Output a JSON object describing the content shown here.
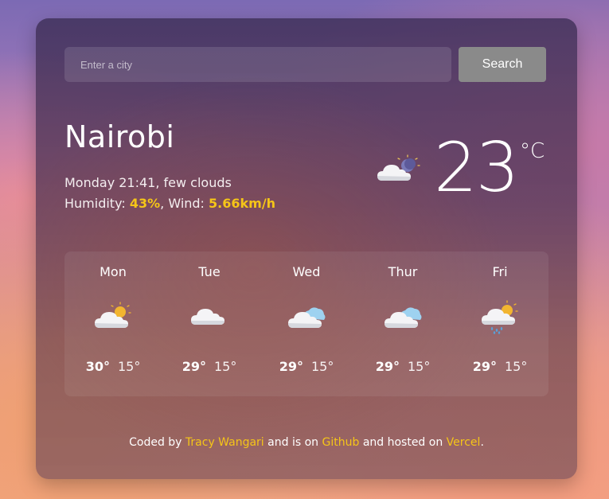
{
  "search": {
    "placeholder": "Enter a city",
    "button_label": "Search"
  },
  "current": {
    "city": "Nairobi",
    "datetime": "Monday 21:41",
    "description": "few clouds",
    "humidity_label": "Humidity:",
    "humidity_value": "43%",
    "wind_label": "Wind:",
    "wind_value": "5.66km/h",
    "temperature": "23",
    "unit": "°C",
    "icon": "moon-cloud-icon"
  },
  "forecast": [
    {
      "day": "Mon",
      "max": "30°",
      "min": "15°",
      "icon": "sun-cloud-icon"
    },
    {
      "day": "Tue",
      "max": "29°",
      "min": "15°",
      "icon": "cloud-icon"
    },
    {
      "day": "Wed",
      "max": "29°",
      "min": "15°",
      "icon": "clouds-icon"
    },
    {
      "day": "Thur",
      "max": "29°",
      "min": "15°",
      "icon": "clouds-icon"
    },
    {
      "day": "Fri",
      "max": "29°",
      "min": "15°",
      "icon": "sun-rain-cloud-icon"
    }
  ],
  "footer": {
    "prefix": "Coded by",
    "author": "Tracy Wangari",
    "middle1": "and is on",
    "github": "Github",
    "middle2": "and hosted on",
    "vercel": "Vercel",
    "suffix": "."
  },
  "colors": {
    "accent": "#f5c518",
    "button": "#8a8a8a"
  }
}
